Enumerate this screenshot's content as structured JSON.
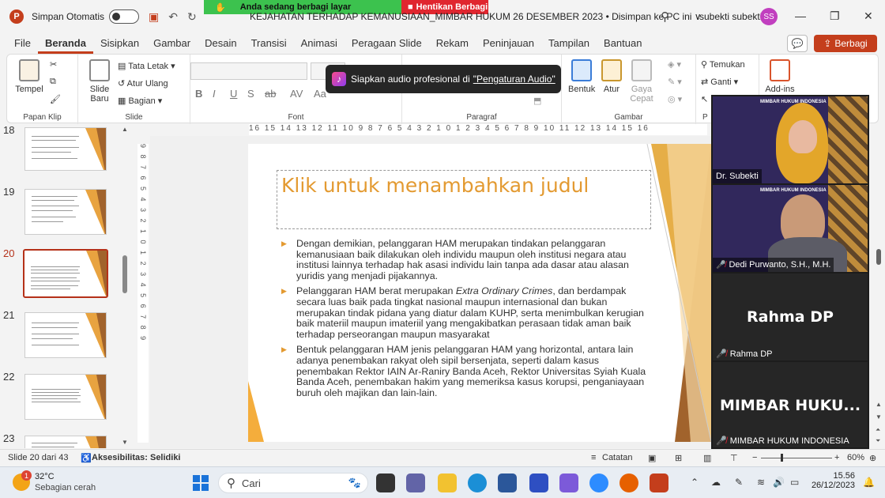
{
  "titlebar": {
    "app_logo": "P",
    "autosave_label": "Simpan Otomatis",
    "document_title": "KEJAHATAN TERHADAP KEMANUSIAAN_MIMBAR HUKUM 26 DESEMBER 2023 • Disimpan ke PC ini ∨",
    "user_name": "subekti subekti",
    "user_initials": "SS",
    "minimize": "—",
    "restore": "❐",
    "close": "✕"
  },
  "share_banner": {
    "status": "Anda sedang berbagi layar",
    "stop_label": "Hentikan Berbagi",
    "green_color": "#3cc24e",
    "red_color": "#e0262f"
  },
  "menu": {
    "tabs": [
      "File",
      "Beranda",
      "Sisipkan",
      "Gambar",
      "Desain",
      "Transisi",
      "Animasi",
      "Peragaan Slide",
      "Rekam",
      "Peninjauan",
      "Tampilan",
      "Bantuan"
    ],
    "active": "Beranda",
    "share_label": "Berbagi"
  },
  "ribbon": {
    "paste_label": "Tempel",
    "clipboard_group": "Papan Klip",
    "new_slide_label_1": "Slide",
    "new_slide_label_2": "Baru",
    "layout_label": "Tata Letak",
    "reset_label": "Atur Ulang",
    "section_label": "Bagian",
    "slide_group": "Slide",
    "font_group": "Font",
    "paragraph_group": "Paragraf",
    "shape_label": "Bentuk",
    "arrange_label": "Atur",
    "quick_styles_label_1": "Gaya",
    "quick_styles_label_2": "Cepat",
    "drawing_group": "Gambar",
    "find_label": "Temukan",
    "replace_label": "Ganti",
    "addins_label": "Add-ins",
    "editing_group_initial": "P"
  },
  "audio_toast": {
    "text": "Siapkan audio profesional di",
    "link": "\"Pengaturan Audio\""
  },
  "thumbnails": {
    "numbers": [
      "18",
      "19",
      "20",
      "21",
      "22",
      "23"
    ],
    "selected": "20"
  },
  "rulers": {
    "horizontal": "16 15 14 13 12 11 10 9 8 7 6 5 4 3 2 1 0 1 2 3 4 5 6 7 8 9 10 11 12 13 14 15 16",
    "vertical": "9 8 7 6 5 4 3 2 1 0 1 2 3 4 5 6 7 8 9"
  },
  "slide": {
    "title_placeholder": "Klik untuk menambahkan judul",
    "accent_color": "#e39a31",
    "bullet_1": "Dengan demikian, pelanggaran HAM merupakan tindakan pelanggaran kemanusiaan baik dilakukan oleh individu maupun oleh institusi negara atau institusi lainnya terhadap hak asasi individu lain tanpa ada dasar atau alasan yuridis yang menjadi pijakannya.",
    "bullet_2_pre": "Pelanggaran HAM berat merupakan ",
    "bullet_2_italic": "Extra Ordinary Crimes",
    "bullet_2_post": ", dan berdampak secara luas baik pada tingkat nasional maupun internasional dan bukan merupakan tindak pidana yang diatur dalam KUHP, serta menimbulkan kerugian baik materiil maupun imateriil yang mengakibatkan perasaan tidak aman baik terhadap perseorangan maupun masyarakat",
    "bullet_3": "Bentuk pelanggaran HAM jenis pelanggaran HAM yang horizontal, antara lain adanya penembakan rakyat oleh sipil bersenjata, seperti dalam kasus penembakan Rektor IAIN Ar-Raniry Banda Aceh, Rektor Universitas Syiah Kuala Banda Aceh, penembakan hakim yang memeriksa kasus korupsi, penganiayaan buruh oleh majikan dan lain-lain."
  },
  "video_panel": {
    "participant_1": "Dr. Subekti",
    "participant_2": "Dedi Purwanto, S.H., M.H.",
    "participant_3_big": "Rahma DP",
    "participant_3_label": "Rahma DP",
    "participant_4_big": "MIMBAR HUKU...",
    "participant_4_label": "MIMBAR HUKUM INDONESIA",
    "banner_header": "MIMBAR HUKUM INDONESIA"
  },
  "statusbar": {
    "slide_count": "Slide 20 dari 43",
    "accessibility": "Aksesibilitas: Selidiki",
    "notes": "Catatan",
    "zoom_minus": "−",
    "zoom_plus": "+",
    "zoom": "60%"
  },
  "taskbar": {
    "temperature": "32°C",
    "weather": "Sebagian cerah",
    "weather_badge": "1",
    "search": "Cari",
    "time": "15.56",
    "date": "26/12/2023"
  }
}
